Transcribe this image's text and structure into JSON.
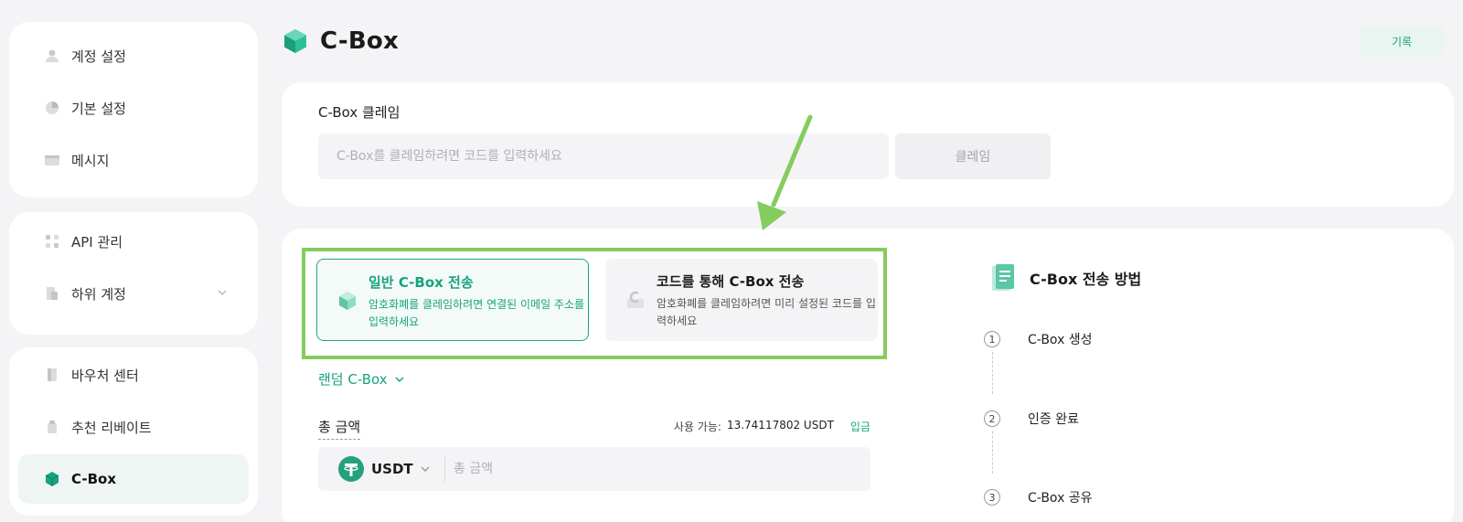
{
  "sidebar": {
    "group1": [
      {
        "label": "계정 설정",
        "icon": "user-icon"
      },
      {
        "label": "기본 설정",
        "icon": "pie-icon"
      },
      {
        "label": "메시지",
        "icon": "message-icon"
      }
    ],
    "group2": [
      {
        "label": "API 관리",
        "icon": "api-icon"
      },
      {
        "label": "하위 계정",
        "icon": "subaccount-icon"
      }
    ],
    "group3": [
      {
        "label": "바우처 센터",
        "icon": "voucher-icon"
      },
      {
        "label": "추천 리베이트",
        "icon": "referral-icon"
      },
      {
        "label": "C-Box",
        "icon": "cbox-icon",
        "active": true
      }
    ]
  },
  "header": {
    "title": "C-Box",
    "history_label": "기록"
  },
  "claim": {
    "label": "C-Box 클레임",
    "placeholder": "C-Box를 클레임하려면 코드를 입력하세요",
    "button": "클레임"
  },
  "send": {
    "options": [
      {
        "title": "일반 C-Box 전송",
        "desc": "암호화폐를 클레임하려면 연결된 이메일 주소를 입력하세요",
        "selected": true
      },
      {
        "title": "코드를 통해 C-Box 전송",
        "desc": "암호화폐를 클레임하려면 미리 설정된 코드를 입력하세요",
        "selected": false
      }
    ],
    "random_label": "랜덤 C-Box",
    "total_label": "총 금액",
    "available_label": "사용 가능:",
    "available_value": "13.74117802 USDT",
    "deposit_label": "입금",
    "currency": "USDT",
    "amount_placeholder": "총 금액"
  },
  "guide": {
    "title": "C-Box 전송 방법",
    "steps": [
      {
        "num": "1",
        "label": "C-Box 생성"
      },
      {
        "num": "2",
        "label": "인증 완료"
      },
      {
        "num": "3",
        "label": "C-Box 공유"
      }
    ]
  },
  "colors": {
    "accent": "#17a37e",
    "highlight": "#84cc5e",
    "background": "#f4f4f6"
  }
}
